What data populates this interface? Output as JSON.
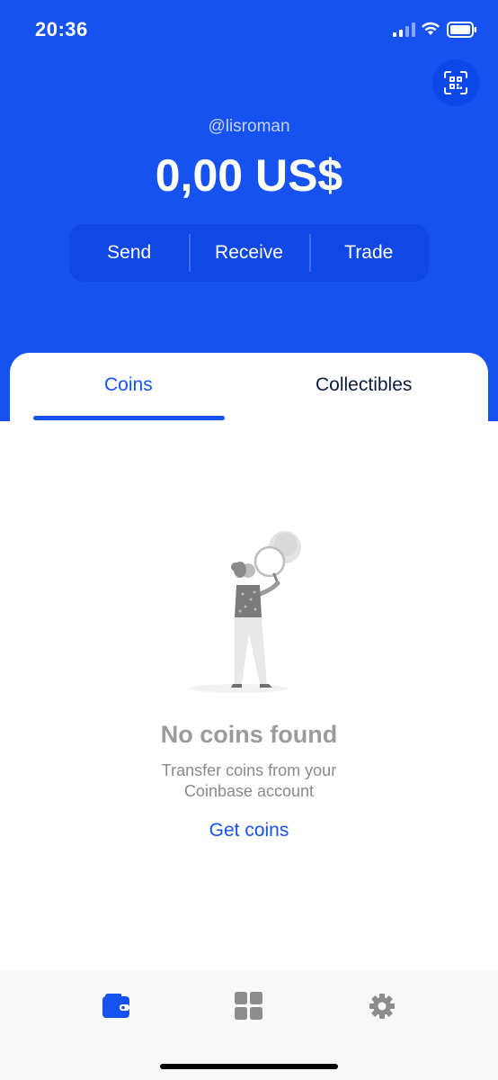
{
  "status_bar": {
    "time": "20:36",
    "icons": [
      "signal-icon",
      "wifi-icon",
      "battery-icon"
    ]
  },
  "header": {
    "qr_icon": "qr-scan-icon",
    "username": "@lisroman",
    "balance": "0,00 US$",
    "actions": {
      "send": "Send",
      "receive": "Receive",
      "trade": "Trade"
    }
  },
  "tabs": {
    "coins": "Coins",
    "collectibles": "Collectibles",
    "active": "Coins"
  },
  "empty_state": {
    "title": "No coins found",
    "description_line1": "Transfer coins from your",
    "description_line2": "Coinbase account",
    "cta": "Get coins"
  },
  "bottom_nav": {
    "items": [
      "wallet-icon",
      "apps-grid-icon",
      "settings-gear-icon"
    ],
    "active": "wallet-icon"
  },
  "colors": {
    "brand_blue": "#1652f0",
    "text_dark": "#0c1c3b",
    "muted_gray": "#9b9b9b"
  }
}
